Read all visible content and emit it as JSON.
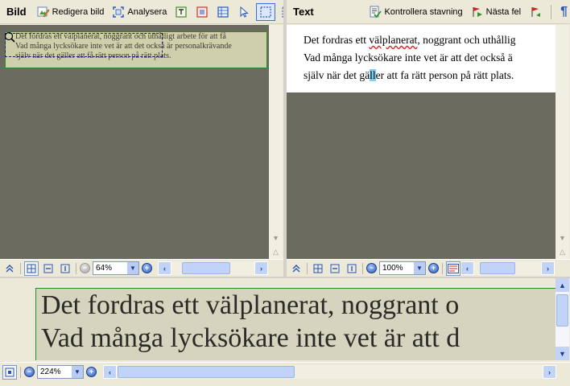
{
  "image_pane": {
    "title": "Bild",
    "edit_label": "Redigera bild",
    "analyze_label": "Analysera",
    "zoom": "64%",
    "doc_lines": [
      "Det fordras ett välplanerat, noggrant och uthålligt arbete för att få",
      "Vad många lycksökare inte vet är att det också är personalkrävande",
      "själv när det gäller att få rätt person på rätt plats."
    ]
  },
  "text_pane": {
    "title": "Text",
    "spellcheck_label": "Kontrollera stavning",
    "next_error_label": "Nästa fel",
    "zoom": "100%",
    "line1_a": "Det fordras ett ",
    "line1_spell": "välplanerat",
    "line1_b": ", noggrant och uthållig",
    "line2": "Vad många lycksökare inte vet är att det också ä",
    "line3_a": "själv när det gä",
    "line3_caret": "ll",
    "line3_b": "er att fa rätt person på rätt plats."
  },
  "zoom_pane": {
    "zoom": "224%",
    "lines": [
      "Det fordras ett välplanerat, noggrant o",
      "Vad många lycksökare inte vet är att d"
    ]
  },
  "colors": {
    "accent": "#3d6fd8",
    "canvas": "#6b6a5e",
    "doc_green_border": "#2c8c2c"
  }
}
